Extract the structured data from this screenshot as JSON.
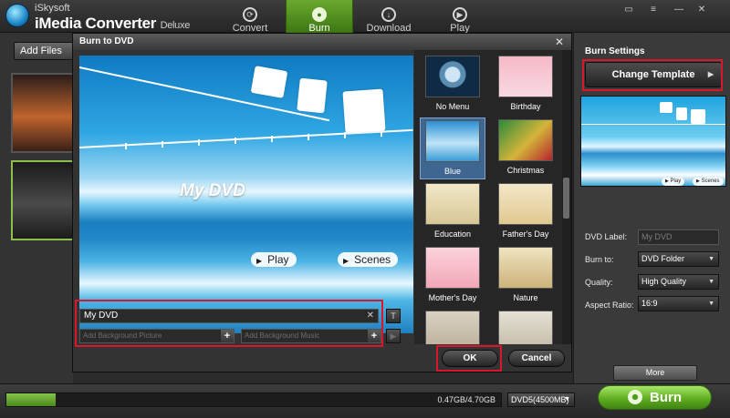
{
  "app": {
    "brand_small": "iSkysoft",
    "brand_big": "iMedia Converter",
    "brand_suffix": "Deluxe",
    "accent": "#5fae20"
  },
  "nav": {
    "tabs": [
      {
        "label": "Convert",
        "icon": "refresh-icon"
      },
      {
        "label": "Burn",
        "icon": "disc-icon",
        "active": true
      },
      {
        "label": "Download",
        "icon": "download-icon"
      },
      {
        "label": "Play",
        "icon": "play-icon"
      }
    ]
  },
  "window": {
    "icons": [
      "chat-icon",
      "menu-icon",
      "minimize-icon",
      "close-icon"
    ]
  },
  "left": {
    "add_files_label": "Add Files"
  },
  "dialog": {
    "title": "Burn to DVD",
    "preview": {
      "menu_title": "My DVD",
      "buttons": [
        "Play",
        "Scenes"
      ]
    },
    "name_value": "My DVD",
    "bg_picture_placeholder": "Add Background Picture",
    "bg_music_placeholder": "Add Background Music",
    "ok_label": "OK",
    "cancel_label": "Cancel",
    "templates": [
      {
        "label": "No Menu"
      },
      {
        "label": "Birthday"
      },
      {
        "label": "Blue",
        "selected": true
      },
      {
        "label": "Christmas"
      },
      {
        "label": "Education"
      },
      {
        "label": "Father's Day"
      },
      {
        "label": "Mother's Day"
      },
      {
        "label": "Nature"
      },
      {
        "label": ""
      },
      {
        "label": ""
      }
    ]
  },
  "settings": {
    "title": "Burn Settings",
    "change_template_label": "Change Template",
    "preview_buttons": [
      "Play",
      "Scenes"
    ],
    "dvd_label": {
      "label": "DVD Label:",
      "value": "My DVD"
    },
    "burn_to": {
      "label": "Burn to:",
      "value": "DVD Folder"
    },
    "quality": {
      "label": "Quality:",
      "value": "High Quality"
    },
    "aspect_ratio": {
      "label": "Aspect Ratio:",
      "value": "16:9"
    },
    "more_label": "More"
  },
  "footer": {
    "progress_text": "0.47GB/4.70GB",
    "progress_fraction": 0.1,
    "disc_type": "DVD5(4500MB)",
    "burn_label": "Burn"
  }
}
